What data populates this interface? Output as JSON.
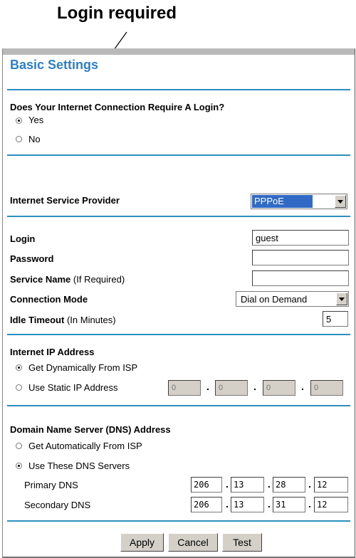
{
  "annotation": {
    "title": "Login required"
  },
  "page": {
    "header": "Basic Settings"
  },
  "login_question": {
    "label": "Does Your Internet Connection Require A Login?",
    "options": [
      {
        "label": "Yes",
        "selected": true
      },
      {
        "label": "No",
        "selected": false
      }
    ]
  },
  "isp": {
    "label": "Internet Service Provider",
    "value": "PPPoE"
  },
  "fields": {
    "login": {
      "label": "Login",
      "value": "guest"
    },
    "password": {
      "label": "Password",
      "value": ""
    },
    "service_name": {
      "label": "Service Name",
      "hint": "(If Required)",
      "value": ""
    },
    "connection_mode": {
      "label": "Connection Mode",
      "value": "Dial on Demand"
    },
    "idle_timeout": {
      "label": "Idle Timeout",
      "hint": "(In Minutes)",
      "value": "5"
    }
  },
  "internet_ip": {
    "label": "Internet IP Address",
    "dynamic_label": "Get Dynamically From ISP",
    "static_label": "Use Static IP Address",
    "selected": "dynamic",
    "static_ip": [
      "0",
      "0",
      "0",
      "0"
    ]
  },
  "dns": {
    "label": "Domain Name Server (DNS) Address",
    "auto_label": "Get Automatically From ISP",
    "manual_label": "Use These DNS Servers",
    "selected": "manual",
    "primary_label": "Primary DNS",
    "primary": [
      "206",
      "13",
      "28",
      "12"
    ],
    "secondary_label": "Secondary DNS",
    "secondary": [
      "206",
      "13",
      "31",
      "12"
    ]
  },
  "buttons": {
    "apply": "Apply",
    "cancel": "Cancel",
    "test": "Test"
  },
  "colors": {
    "header": "#2f7fc4",
    "separator": "#2a8fbf",
    "button_face": "#d4d0c8",
    "selection": "#316ac5"
  }
}
